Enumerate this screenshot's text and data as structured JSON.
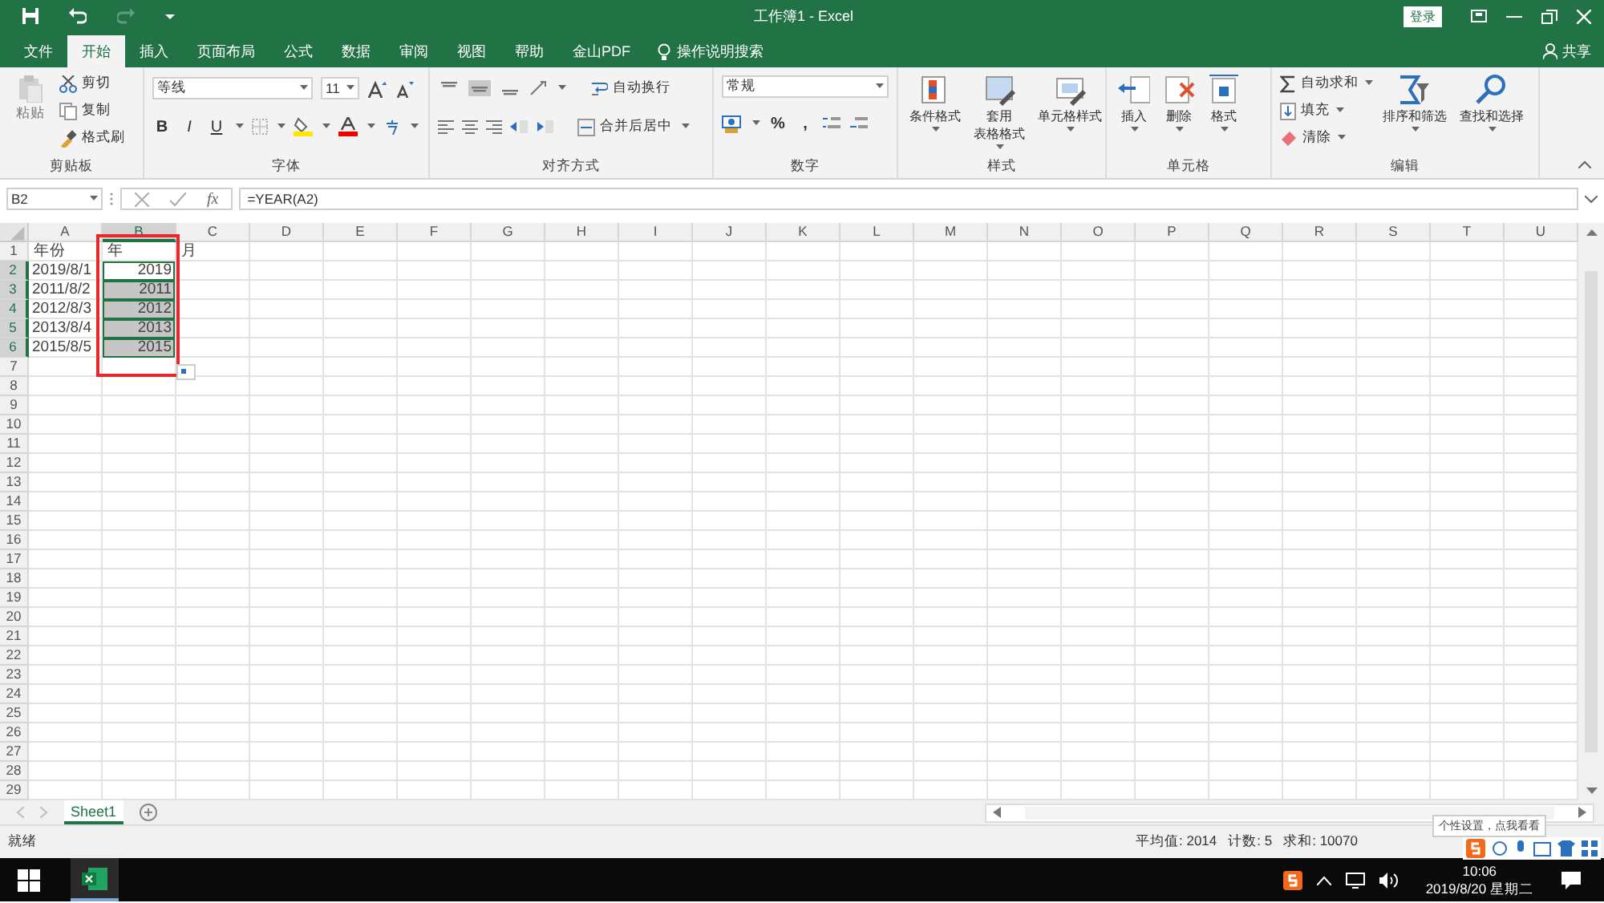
{
  "window": {
    "title": "工作簿1 - Excel",
    "sign_in": "登录"
  },
  "tabs": [
    {
      "label": "文件",
      "selected": false
    },
    {
      "label": "开始",
      "selected": true
    },
    {
      "label": "插入",
      "selected": false
    },
    {
      "label": "页面布局",
      "selected": false
    },
    {
      "label": "公式",
      "selected": false
    },
    {
      "label": "数据",
      "selected": false
    },
    {
      "label": "审阅",
      "selected": false
    },
    {
      "label": "视图",
      "selected": false
    },
    {
      "label": "帮助",
      "selected": false
    },
    {
      "label": "金山PDF",
      "selected": false
    }
  ],
  "tell_me": "操作说明搜索",
  "share": "共享",
  "ribbon": [
    {
      "kind": "clipboard",
      "label": "剪贴板",
      "paste": {
        "label": "粘贴",
        "disabled": true
      },
      "items": [
        "剪切",
        "复制",
        "格式刷"
      ]
    },
    {
      "kind": "font",
      "label": "字体",
      "font_name": "等线",
      "font_size": "11",
      "buttons": [
        "B",
        "I",
        "U"
      ]
    },
    {
      "kind": "alignment",
      "label": "对齐方式",
      "wrap": "自动换行",
      "merge": "合并后居中"
    },
    {
      "kind": "number",
      "label": "数字",
      "format": "常规",
      "buttons": [
        "%",
        ","
      ]
    },
    {
      "kind": "large",
      "label": "样式",
      "buttons": [
        [
          "条件格式"
        ],
        [
          "套用",
          "表格格式"
        ],
        [
          "单元格样式"
        ]
      ]
    },
    {
      "kind": "large",
      "label": "单元格",
      "buttons": [
        [
          "插入"
        ],
        [
          "删除"
        ],
        [
          "格式"
        ]
      ]
    },
    {
      "kind": "editing",
      "label": "编辑",
      "items": [
        "自动求和",
        "填充",
        "清除"
      ],
      "buttons": [
        "排序和筛选",
        "查找和选择"
      ]
    }
  ],
  "formula_bar": {
    "name_box": "B2",
    "function_label": "fx",
    "formula": "=YEAR(A2)"
  },
  "sheet": {
    "columns": [
      {
        "label": "A",
        "selected": false
      },
      {
        "label": "B",
        "selected": true
      },
      {
        "label": "C",
        "selected": false
      },
      {
        "label": "D",
        "selected": false
      },
      {
        "label": "E",
        "selected": false
      },
      {
        "label": "F",
        "selected": false
      },
      {
        "label": "G",
        "selected": false
      },
      {
        "label": "H",
        "selected": false
      },
      {
        "label": "I",
        "selected": false
      },
      {
        "label": "J",
        "selected": false
      },
      {
        "label": "K",
        "selected": false
      },
      {
        "label": "L",
        "selected": false
      },
      {
        "label": "M",
        "selected": false
      },
      {
        "label": "N",
        "selected": false
      },
      {
        "label": "O",
        "selected": false
      },
      {
        "label": "P",
        "selected": false
      },
      {
        "label": "Q",
        "selected": false
      },
      {
        "label": "R",
        "selected": false
      },
      {
        "label": "S",
        "selected": false
      },
      {
        "label": "T",
        "selected": false
      },
      {
        "label": "U",
        "selected": false
      }
    ],
    "rows": [
      {
        "label": "1",
        "selected": false,
        "cells": [
          {
            "text": "年份",
            "kind": "text",
            "selected": false,
            "active": false
          },
          {
            "text": "年",
            "kind": "text",
            "selected": false,
            "active": false
          },
          {
            "text": "月",
            "kind": "text",
            "selected": false,
            "active": false
          }
        ]
      },
      {
        "label": "2",
        "selected": true,
        "cells": [
          {
            "text": "2019/8/1",
            "kind": "date",
            "selected": false,
            "active": false
          },
          {
            "text": "2019",
            "kind": "number",
            "selected": true,
            "active": true
          }
        ]
      },
      {
        "label": "3",
        "selected": true,
        "cells": [
          {
            "text": "2011/8/2",
            "kind": "date",
            "selected": false,
            "active": false
          },
          {
            "text": "2011",
            "kind": "number",
            "selected": true,
            "active": false
          }
        ]
      },
      {
        "label": "4",
        "selected": true,
        "cells": [
          {
            "text": "2012/8/3",
            "kind": "date",
            "selected": false,
            "active": false
          },
          {
            "text": "2012",
            "kind": "number",
            "selected": true,
            "active": false
          }
        ]
      },
      {
        "label": "5",
        "selected": true,
        "cells": [
          {
            "text": "2013/8/4",
            "kind": "date",
            "selected": false,
            "active": false
          },
          {
            "text": "2013",
            "kind": "number",
            "selected": true,
            "active": false
          }
        ]
      },
      {
        "label": "6",
        "selected": true,
        "cells": [
          {
            "text": "2015/8/5",
            "kind": "date",
            "selected": false,
            "active": false
          },
          {
            "text": "2015",
            "kind": "number",
            "selected": true,
            "active": false
          }
        ]
      },
      {
        "label": "7",
        "selected": false
      },
      {
        "label": "8",
        "selected": false
      },
      {
        "label": "9",
        "selected": false
      },
      {
        "label": "10",
        "selected": false
      },
      {
        "label": "11",
        "selected": false
      },
      {
        "label": "12",
        "selected": false
      },
      {
        "label": "13",
        "selected": false
      },
      {
        "label": "14",
        "selected": false
      },
      {
        "label": "15",
        "selected": false
      },
      {
        "label": "16",
        "selected": false
      },
      {
        "label": "17",
        "selected": false
      },
      {
        "label": "18",
        "selected": false
      },
      {
        "label": "19",
        "selected": false
      },
      {
        "label": "20",
        "selected": false
      },
      {
        "label": "21",
        "selected": false
      },
      {
        "label": "22",
        "selected": false
      },
      {
        "label": "23",
        "selected": false
      },
      {
        "label": "24",
        "selected": false
      },
      {
        "label": "25",
        "selected": false
      },
      {
        "label": "26",
        "selected": false
      },
      {
        "label": "27",
        "selected": false
      },
      {
        "label": "28",
        "selected": false
      },
      {
        "label": "29",
        "selected": false
      }
    ]
  },
  "sheet_tabs": [
    {
      "label": "Sheet1",
      "selected": true
    }
  ],
  "status_bar": {
    "mode": "就绪",
    "stats": [
      "平均值: 2014",
      "计数: 5",
      "求和: 10070"
    ]
  },
  "tooltip": "个性设置，点我看看",
  "taskbar": {
    "time": "10:06",
    "date": "2019/8/20 星期二"
  }
}
